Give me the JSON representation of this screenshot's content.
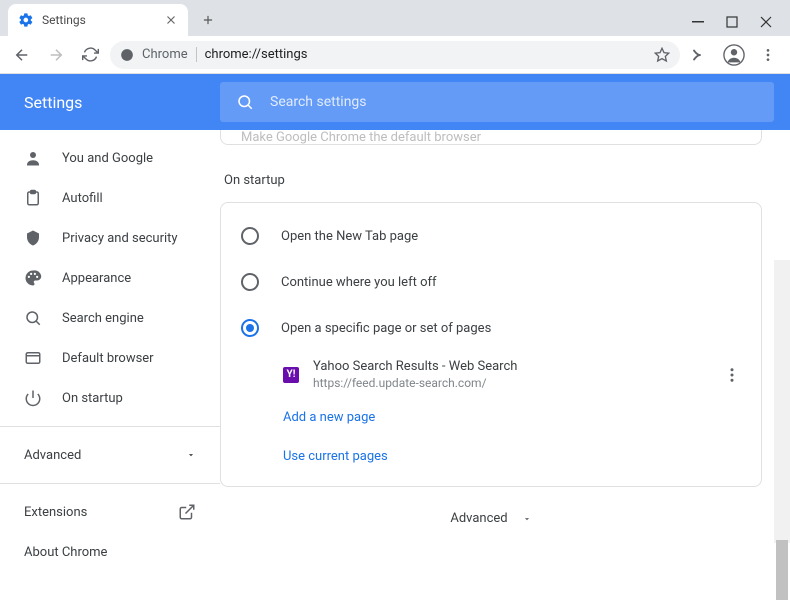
{
  "window": {
    "tab_title": "Settings"
  },
  "omnibox": {
    "prefix": "Chrome",
    "path": "chrome://settings"
  },
  "header": {
    "title": "Settings",
    "search_placeholder": "Search settings"
  },
  "sidebar": {
    "items": [
      {
        "label": "You and Google",
        "icon": "person"
      },
      {
        "label": "Autofill",
        "icon": "autofill"
      },
      {
        "label": "Privacy and security",
        "icon": "shield"
      },
      {
        "label": "Appearance",
        "icon": "palette"
      },
      {
        "label": "Search engine",
        "icon": "search"
      },
      {
        "label": "Default browser",
        "icon": "browser"
      },
      {
        "label": "On startup",
        "icon": "power"
      }
    ],
    "advanced": "Advanced",
    "extensions": "Extensions",
    "about": "About Chrome"
  },
  "main": {
    "partial_text": "Make Google Chrome the default browser",
    "section_title": "On startup",
    "options": [
      {
        "label": "Open the New Tab page",
        "checked": false
      },
      {
        "label": "Continue where you left off",
        "checked": false
      },
      {
        "label": "Open a specific page or set of pages",
        "checked": true
      }
    ],
    "pages": [
      {
        "title": "Yahoo Search Results - Web Search",
        "url": "https://feed.update-search.com/"
      }
    ],
    "add_page": "Add a new page",
    "use_current": "Use current pages",
    "advanced": "Advanced"
  }
}
